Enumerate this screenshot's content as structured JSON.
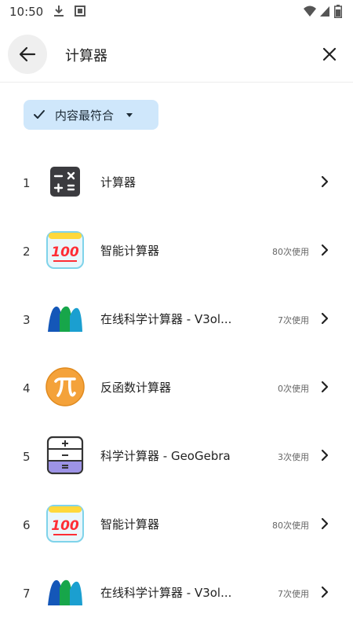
{
  "status_bar": {
    "time": "10:50",
    "icons": [
      "download-icon",
      "notification-icon",
      "wifi-icon",
      "signal-icon",
      "battery-icon"
    ]
  },
  "header": {
    "back_icon": "arrow-left-icon",
    "search_text": "计算器",
    "close_icon": "close-icon"
  },
  "filter": {
    "check_icon": "check-icon",
    "label": "内容最符合",
    "dropdown_icon": "caret-down-icon"
  },
  "results": [
    {
      "rank": "1",
      "name": "计算器",
      "usage": "",
      "icon": "calculator-grid-icon"
    },
    {
      "rank": "2",
      "name": "智能计算器",
      "usage": "80次使用",
      "icon": "emoji-100-icon"
    },
    {
      "rank": "3",
      "name": "在线科学计算器 - V3ol...",
      "usage": "7次使用",
      "icon": "m-logo-icon"
    },
    {
      "rank": "4",
      "name": "反函数计算器",
      "usage": "0次使用",
      "icon": "pi-icon"
    },
    {
      "rank": "5",
      "name": "科学计算器 - GeoGebra",
      "usage": "3次使用",
      "icon": "geogebra-calculator-icon"
    },
    {
      "rank": "6",
      "name": "智能计算器",
      "usage": "80次使用",
      "icon": "emoji-100-icon"
    },
    {
      "rank": "7",
      "name": "在线科学计算器 - V3ol...",
      "usage": "7次使用",
      "icon": "m-logo-icon"
    }
  ],
  "colors": {
    "chip_background": "#cfe7fb",
    "back_button_background": "#efefef"
  }
}
